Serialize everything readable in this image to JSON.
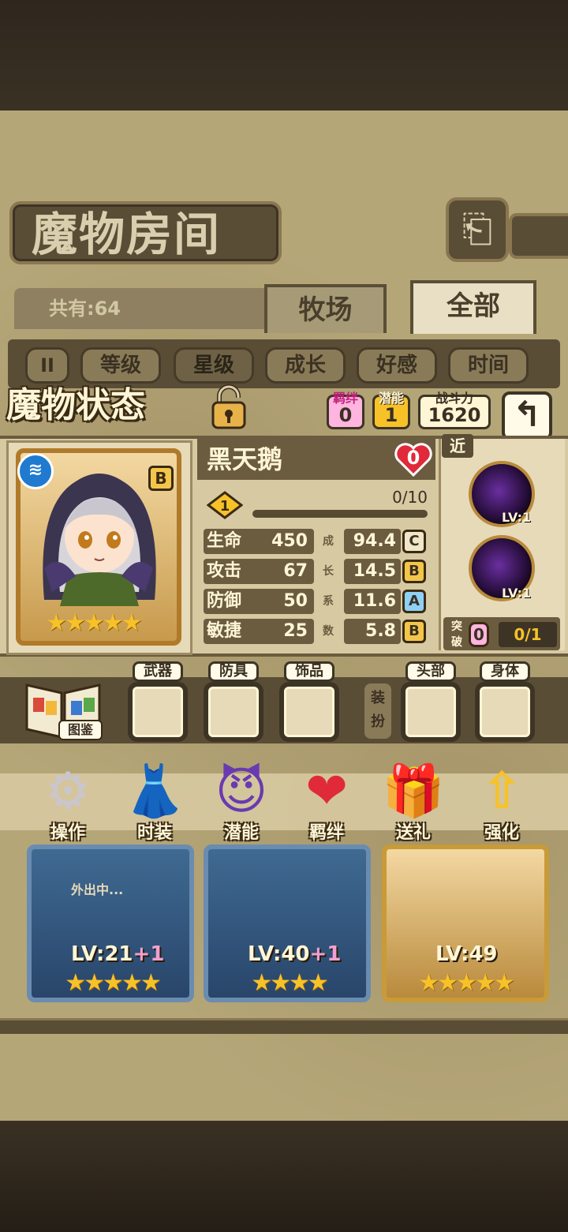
{
  "header": {
    "title": "魔物房间",
    "back_icon": "return-icon"
  },
  "filter": {
    "count": "共有:64",
    "tabs": [
      {
        "label": "牧场"
      },
      {
        "label": "全部"
      }
    ],
    "sort": [
      {
        "label": "等级"
      },
      {
        "label": "星级"
      },
      {
        "label": "成长"
      },
      {
        "label": "好感"
      },
      {
        "label": "时间"
      }
    ]
  },
  "status": {
    "title": "魔物状态",
    "bond": {
      "label": "羁绊",
      "value": "0"
    },
    "potential": {
      "label": "潜能",
      "value": "1"
    },
    "power": {
      "label": "战斗力",
      "value": "1620"
    }
  },
  "monster": {
    "name": "黑天鹅",
    "grade": "B",
    "hearts": "0",
    "star_level": "1",
    "exp": "0/10",
    "exp_fraction": 0,
    "stats": [
      {
        "name": "生命",
        "value": "450",
        "growth": "94.4",
        "grade": "C",
        "grade_color": "#f0e6c8"
      },
      {
        "name": "攻击",
        "value": "67",
        "growth": "14.5",
        "grade": "B",
        "grade_color": "#f3c64a"
      },
      {
        "name": "防御",
        "value": "50",
        "growth": "11.6",
        "grade": "A",
        "grade_color": "#8fd0f5"
      },
      {
        "name": "敏捷",
        "value": "25",
        "growth": "5.8",
        "grade": "B",
        "grade_color": "#f3c64a"
      }
    ],
    "growth_chars": [
      "成",
      "长",
      "系",
      "数"
    ]
  },
  "skills": {
    "range": "近",
    "items": [
      {
        "level": "LV:1"
      },
      {
        "level": "LV:1"
      }
    ],
    "break_label": "突破",
    "break_count": "0",
    "break_progress": "0/1"
  },
  "equipment": {
    "book_label": "图鉴",
    "slots": [
      {
        "label": "武器"
      },
      {
        "label": "防具"
      },
      {
        "label": "饰品"
      },
      {
        "label": "头部"
      },
      {
        "label": "身体"
      }
    ],
    "side_tag": "装扮"
  },
  "actions": [
    {
      "label": "操作",
      "icon": "⚙"
    },
    {
      "label": "时装",
      "icon": "👗"
    },
    {
      "label": "潜能",
      "icon": "😈"
    },
    {
      "label": "羁绊",
      "icon": "❤"
    },
    {
      "label": "送礼",
      "icon": "🎁"
    },
    {
      "label": "强化",
      "icon": "⇧"
    }
  ],
  "monsters": [
    {
      "level": "LV:21",
      "plus": "+1",
      "status": "外出中..."
    },
    {
      "level": "LV:40",
      "plus": "+1"
    },
    {
      "level": "LV:49"
    }
  ],
  "colors": {
    "accent_gold": "#f7c228",
    "paper": "#b5a678",
    "wood": "#5a4d36"
  }
}
